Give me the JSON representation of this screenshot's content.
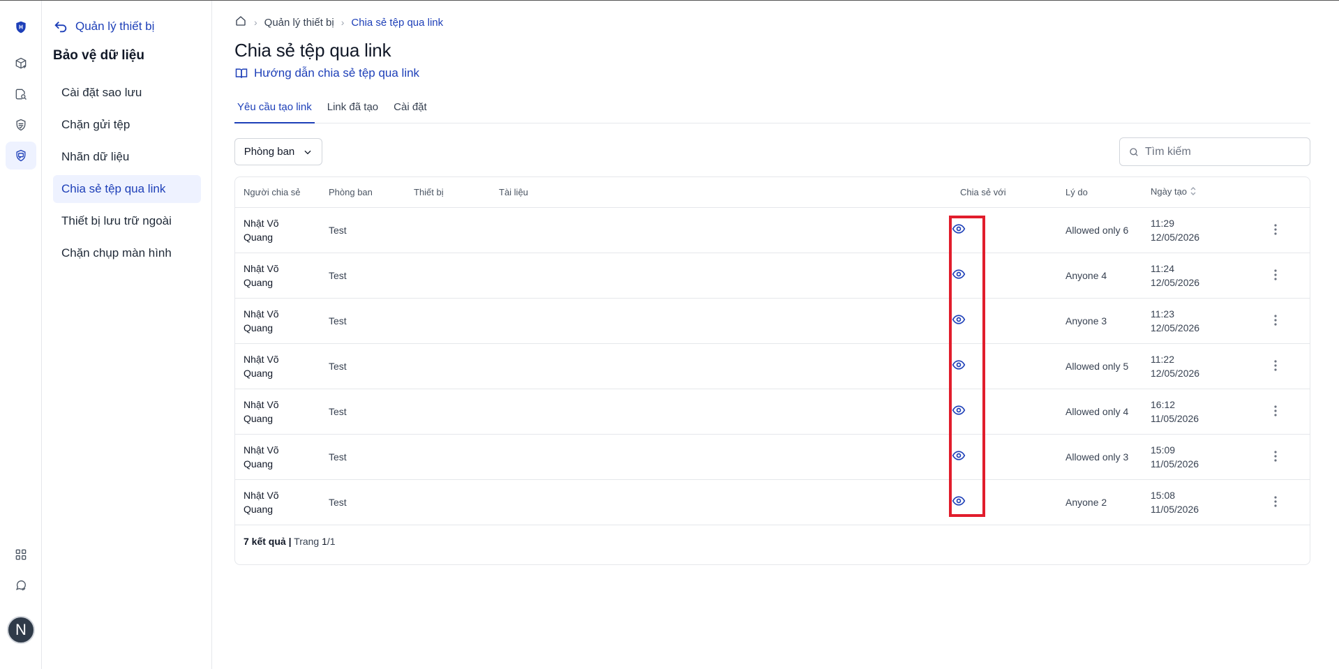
{
  "sidebar": {
    "back_label": "Quản lý thiết bị",
    "title": "Bảo vệ dữ liệu",
    "items": [
      {
        "label": "Cài đặt sao lưu"
      },
      {
        "label": "Chặn gửi tệp"
      },
      {
        "label": "Nhãn dữ liệu"
      },
      {
        "label": "Chia sẻ tệp qua link",
        "active": true
      },
      {
        "label": "Thiết bị lưu trữ ngoài"
      },
      {
        "label": "Chặn chụp màn hình"
      }
    ]
  },
  "rail": {
    "avatar_initial": "N",
    "icons": [
      "shield-logo-icon",
      "box-plus-icon",
      "document-search-icon",
      "shield-check-icon",
      "shield-chat-icon",
      "grid-icon",
      "chat-icon"
    ]
  },
  "breadcrumb": {
    "home_icon": "home-icon",
    "items": [
      "Quản lý thiết bị",
      "Chia sẻ tệp qua link"
    ]
  },
  "page": {
    "title": "Chia sẻ tệp qua link",
    "guide_link": "Hướng dẫn chia sẻ tệp qua link"
  },
  "tabs": [
    {
      "label": "Yêu cầu tạo link",
      "active": true
    },
    {
      "label": "Link đã tạo"
    },
    {
      "label": "Cài đặt"
    }
  ],
  "filter": {
    "department_label": "Phòng ban"
  },
  "search": {
    "placeholder": "Tìm kiếm"
  },
  "table": {
    "headers": [
      "Người chia sẻ",
      "Phòng ban",
      "Thiết bị",
      "Tài liệu",
      "Chia sẻ với",
      "Lý do",
      "Ngày tạo"
    ],
    "rows": [
      {
        "sharer": "Nhật Võ Quang",
        "department": "Test",
        "device": "",
        "document": "",
        "reason": "Allowed only 6",
        "time": "11:29",
        "date": "12/05/2026"
      },
      {
        "sharer": "Nhật Võ Quang",
        "department": "Test",
        "device": "",
        "document": "",
        "reason": "Anyone 4",
        "time": "11:24",
        "date": "12/05/2026"
      },
      {
        "sharer": "Nhật Võ Quang",
        "department": "Test",
        "device": "",
        "document": "",
        "reason": "Anyone 3",
        "time": "11:23",
        "date": "12/05/2026"
      },
      {
        "sharer": "Nhật Võ Quang",
        "department": "Test",
        "device": "",
        "document": "",
        "reason": "Allowed only 5",
        "time": "11:22",
        "date": "12/05/2026"
      },
      {
        "sharer": "Nhật Võ Quang",
        "department": "Test",
        "device": "",
        "document": "",
        "reason": "Allowed only 4",
        "time": "16:12",
        "date": "11/05/2026"
      },
      {
        "sharer": "Nhật Võ Quang",
        "department": "Test",
        "device": "",
        "document": "",
        "reason": "Allowed only 3",
        "time": "15:09",
        "date": "11/05/2026"
      },
      {
        "sharer": "Nhật Võ Quang",
        "department": "Test",
        "device": "",
        "document": "",
        "reason": "Anyone 2",
        "time": "15:08",
        "date": "11/05/2026"
      }
    ],
    "footer": {
      "count": "7 kết quả",
      "separator": "|",
      "page_label": "Trang",
      "current_page": "1",
      "page_sep": "/",
      "total_pages": "1"
    }
  },
  "colors": {
    "accent": "#1d3fb8",
    "highlight": "#e11d2c",
    "active_bg": "#eef2ff"
  }
}
